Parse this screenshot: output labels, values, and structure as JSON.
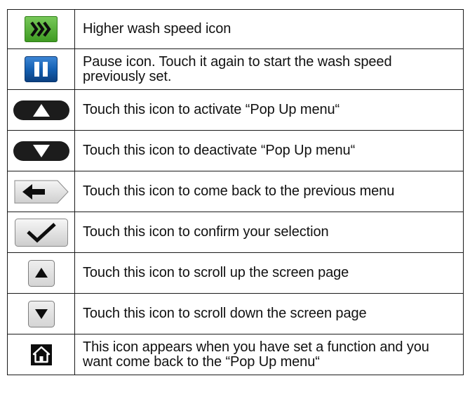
{
  "icon_legend": {
    "rows": [
      {
        "icon": "fast-forward-icon",
        "description": "Higher wash speed icon"
      },
      {
        "icon": "pause-icon",
        "description": "Pause icon. Touch it again to start the wash speed previously set."
      },
      {
        "icon": "pop-up-open-icon",
        "description": "Touch this icon to activate “Pop Up menu“"
      },
      {
        "icon": "pop-up-close-icon",
        "description": "Touch this icon to deactivate “Pop Up menu“"
      },
      {
        "icon": "back-arrow-icon",
        "description": "Touch this icon to come back to the previous menu"
      },
      {
        "icon": "checkmark-icon",
        "description": "Touch this icon to confirm your selection"
      },
      {
        "icon": "scroll-up-icon",
        "description": "Touch this icon to scroll up the screen page"
      },
      {
        "icon": "scroll-down-icon",
        "description": "Touch this icon to scroll down the screen page"
      },
      {
        "icon": "home-icon",
        "description": "This icon appears when you have set a function and you want come back to the “Pop Up menu“"
      }
    ]
  },
  "colors": {
    "fast_forward_green": "#4caf2e",
    "pause_blue": "#1259a8",
    "dark_pill": "#1c1c1c",
    "light_button": "#e4e4e4",
    "home_black": "#0d0d0d"
  }
}
